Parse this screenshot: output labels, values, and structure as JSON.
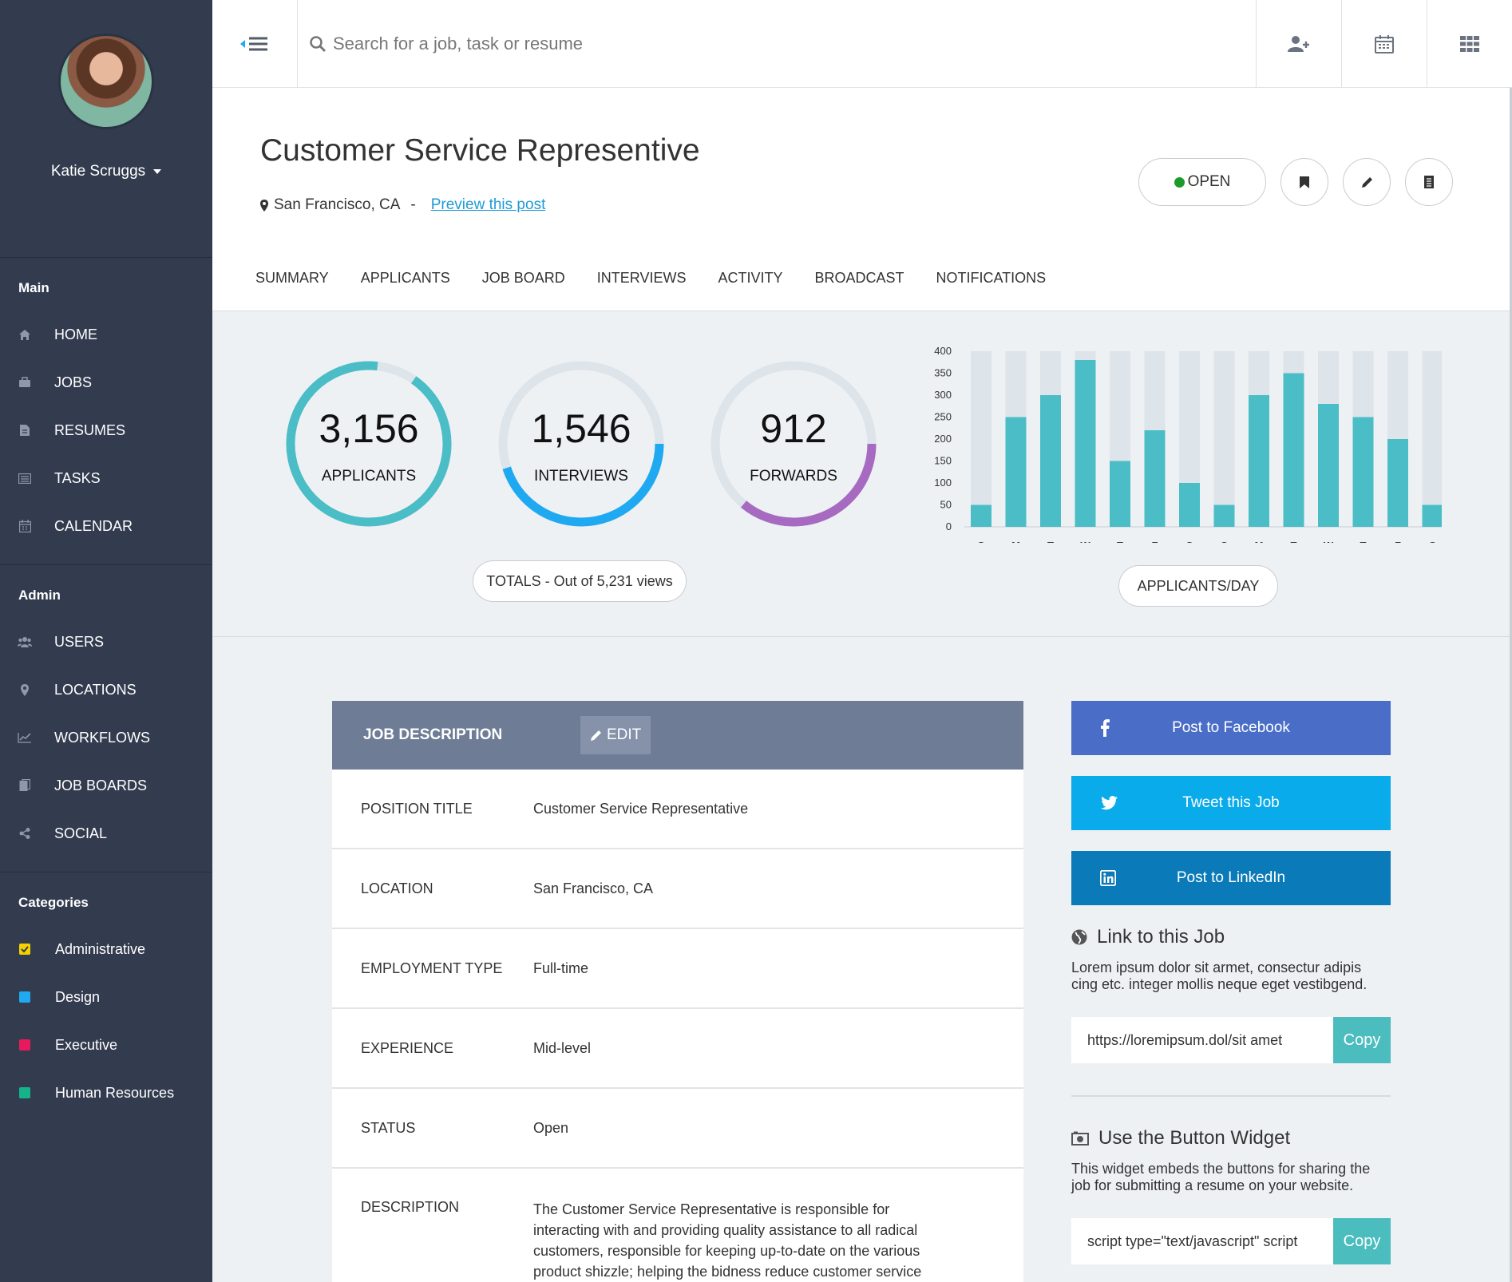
{
  "user": {
    "name": "Katie Scruggs"
  },
  "sidebar": {
    "main": {
      "heading": "Main",
      "items": [
        {
          "label": "HOME",
          "icon": "home-icon"
        },
        {
          "label": "JOBS",
          "icon": "briefcase-icon"
        },
        {
          "label": "RESUMES",
          "icon": "document-icon"
        },
        {
          "label": "TASKS",
          "icon": "list-icon"
        },
        {
          "label": "CALENDAR",
          "icon": "calendar-icon"
        }
      ]
    },
    "admin": {
      "heading": "Admin",
      "items": [
        {
          "label": "USERS",
          "icon": "users-icon"
        },
        {
          "label": "LOCATIONS",
          "icon": "map-pin-icon"
        },
        {
          "label": "WORKFLOWS",
          "icon": "line-chart-icon"
        },
        {
          "label": "JOB BOARDS",
          "icon": "clipboard-icon"
        },
        {
          "label": "SOCIAL",
          "icon": "share-icon"
        }
      ]
    },
    "categories": {
      "heading": "Categories",
      "items": [
        {
          "label": "Administrative",
          "color": "#f5d000",
          "checked": true
        },
        {
          "label": "Design",
          "color": "#1ea9f0"
        },
        {
          "label": "Executive",
          "color": "#e8195c"
        },
        {
          "label": "Human Resources",
          "color": "#16b38a"
        }
      ]
    }
  },
  "search": {
    "placeholder": "Search for a job, task or resume"
  },
  "job": {
    "title": "Customer Service Representive",
    "location": "San Francisco, CA",
    "separator": "-",
    "preview_label": "Preview this post",
    "status_label": "OPEN",
    "status_color": "#1c9b2b"
  },
  "tabs": [
    "SUMMARY",
    "APPLICANTS",
    "JOB BOARD",
    "INTERVIEWS",
    "ACTIVITY",
    "BROADCAST",
    "NOTIFICATIONS"
  ],
  "stats": {
    "applicants": {
      "value": "3,156",
      "label": "APPLICANTS",
      "fraction": 0.92,
      "color": "#4bbdc6"
    },
    "interviews": {
      "value": "1,546",
      "label": "INTERVIEWS",
      "fraction": 0.45,
      "color": "#1ea9f0"
    },
    "forwards": {
      "value": "912",
      "label": "FORWARDS",
      "fraction": 0.36,
      "color": "#a66bc1"
    },
    "totals_label": "TOTALS - Out of 5,231 views",
    "chart_label": "APPLICANTS/DAY"
  },
  "chart_data": {
    "type": "bar",
    "categories": [
      "S",
      "M",
      "T",
      "W",
      "T",
      "F",
      "S",
      "S",
      "M",
      "T",
      "W",
      "T",
      "F",
      "S"
    ],
    "values": [
      50,
      250,
      300,
      380,
      150,
      220,
      100,
      50,
      300,
      350,
      280,
      250,
      200,
      50
    ],
    "ylim": [
      0,
      400
    ],
    "yticks": [
      0,
      50,
      100,
      150,
      200,
      250,
      300,
      350,
      400
    ],
    "bar_color": "#4bbdc6",
    "track_color": "#dde4ea"
  },
  "job_description": {
    "heading": "JOB DESCRIPTION",
    "edit_label": "EDIT",
    "rows": [
      {
        "key": "POSITION TITLE",
        "value": "Customer Service Representative"
      },
      {
        "key": "LOCATION",
        "value": "San Francisco, CA"
      },
      {
        "key": "EMPLOYMENT TYPE",
        "value": "Full-time"
      },
      {
        "key": "EXPERIENCE",
        "value": "Mid-level"
      },
      {
        "key": "STATUS",
        "value": "Open"
      },
      {
        "key": "DESCRIPTION",
        "value": "The Customer Service Representative is responsible for interacting with and providing quality assistance to all radical customers, responsible for keeping up-to-date on the various product shizzle; helping the bidness reduce customer service"
      }
    ]
  },
  "share": {
    "facebook": "Post to Facebook",
    "twitter": "Tweet this Job",
    "linkedin": "Post to LinkedIn"
  },
  "link_section": {
    "title": "Link to this Job",
    "text": "Lorem ipsum dolor sit armet, consectur adipis cing etc. integer mollis neque eget vestibgend.",
    "url": "https://loremipsum.dol/sit amet",
    "copy_label": "Copy"
  },
  "widget_section": {
    "title": "Use the Button Widget",
    "text": "This widget embeds the buttons for sharing the job for submitting a resume on your website.",
    "code": "script type=\"text/javascript\" script",
    "copy_label": "Copy"
  }
}
